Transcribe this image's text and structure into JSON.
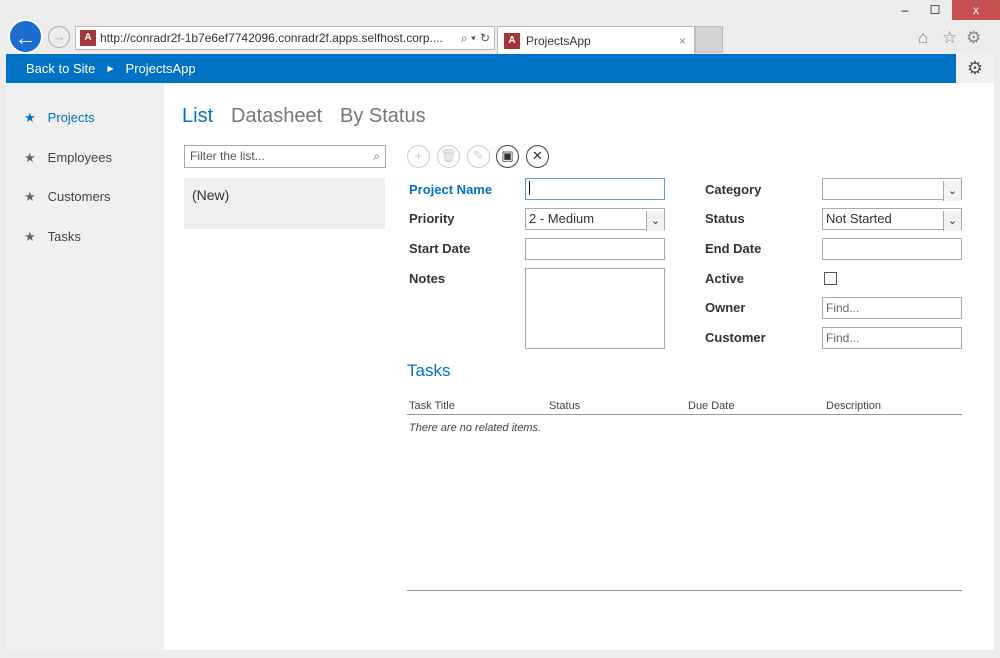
{
  "browser": {
    "url": "http://conradr2f-1b7e6ef7742096.conradr2f.apps.selfhost.corp....",
    "tab_title": "ProjectsApp",
    "min": "‒",
    "max": "☐",
    "close": "x"
  },
  "suitebar": {
    "back": "Back to Site",
    "app": "ProjectsApp"
  },
  "sidebar": {
    "items": [
      {
        "label": "Projects"
      },
      {
        "label": "Employees"
      },
      {
        "label": "Customers"
      },
      {
        "label": "Tasks"
      }
    ]
  },
  "views": [
    "List",
    "Datasheet",
    "By Status"
  ],
  "filter": {
    "placeholder": "Filter the list..."
  },
  "list": {
    "new": "(New)"
  },
  "form": {
    "project_name": "Project Name",
    "priority": "Priority",
    "priority_value": "2 - Medium",
    "start_date": "Start Date",
    "notes": "Notes",
    "category": "Category",
    "status": "Status",
    "status_value": "Not Started",
    "end_date": "End Date",
    "active": "Active",
    "owner": "Owner",
    "customer": "Customer",
    "find": "Find..."
  },
  "tasks": {
    "title": "Tasks",
    "columns": [
      "Task Title",
      "Status",
      "Due Date",
      "Description"
    ],
    "empty": "There are no related items."
  },
  "colors": {
    "accent": "#0072c6"
  }
}
